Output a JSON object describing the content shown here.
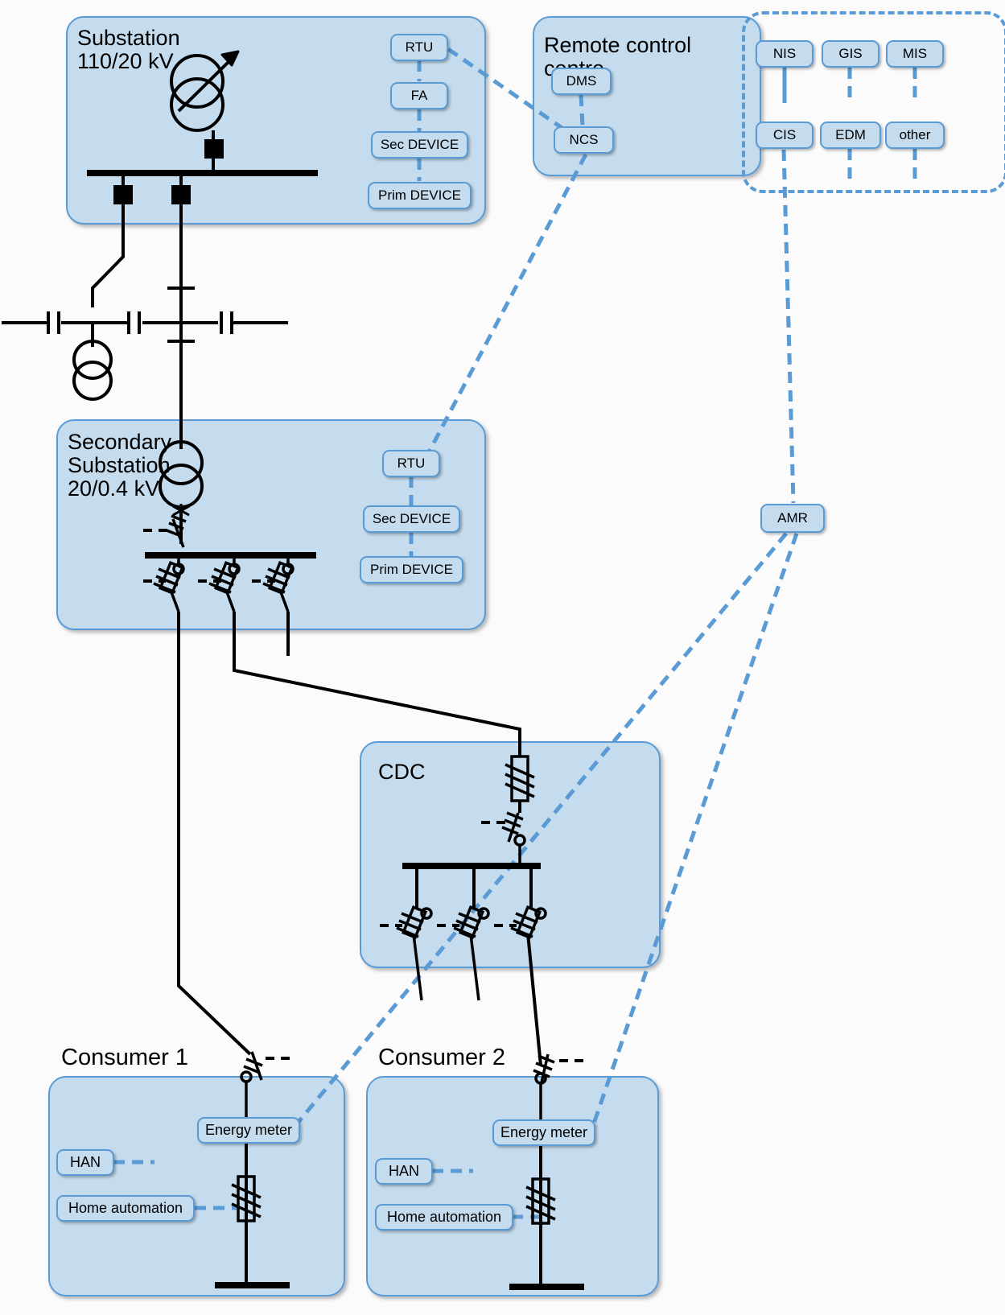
{
  "diagram": {
    "title": "Smart grid architecture: substation, secondary substation, CDC and consumers",
    "accent_color": "#5b9bd5",
    "panel_fill": "#c5dcee",
    "wire_color": "#000000"
  },
  "panels": {
    "substation": {
      "title": "Substation\n110/20 kV"
    },
    "remote_control_centre": {
      "title": "Remote control\n       centre"
    },
    "it_systems_group": {
      "title": ""
    },
    "secondary_substation": {
      "title": "Secondary\nSubstation\n20/0.4 kV"
    },
    "cdc": {
      "title": "CDC"
    },
    "consumer1": {
      "title": "Consumer 1"
    },
    "consumer2": {
      "title": "Consumer 2"
    }
  },
  "chips": {
    "substation": [
      {
        "label": "RTU"
      },
      {
        "label": "FA"
      },
      {
        "label": "Sec DEVICE"
      },
      {
        "label": "Prim DEVICE"
      }
    ],
    "remote_control_centre": [
      {
        "label": "DMS"
      },
      {
        "label": "NCS"
      }
    ],
    "it_systems": [
      {
        "label": "NIS"
      },
      {
        "label": "GIS"
      },
      {
        "label": "MIS"
      },
      {
        "label": "CIS"
      },
      {
        "label": "EDM"
      },
      {
        "label": "other"
      }
    ],
    "secondary_substation": [
      {
        "label": "RTU"
      },
      {
        "label": "Sec DEVICE"
      },
      {
        "label": "Prim DEVICE"
      }
    ],
    "metering": [
      {
        "label": "AMR"
      }
    ],
    "consumer1": [
      {
        "label": "Energy meter"
      },
      {
        "label": "HAN"
      },
      {
        "label": "Home automation"
      }
    ],
    "consumer2": [
      {
        "label": "Energy meter"
      },
      {
        "label": "HAN"
      },
      {
        "label": "Home automation"
      }
    ]
  }
}
